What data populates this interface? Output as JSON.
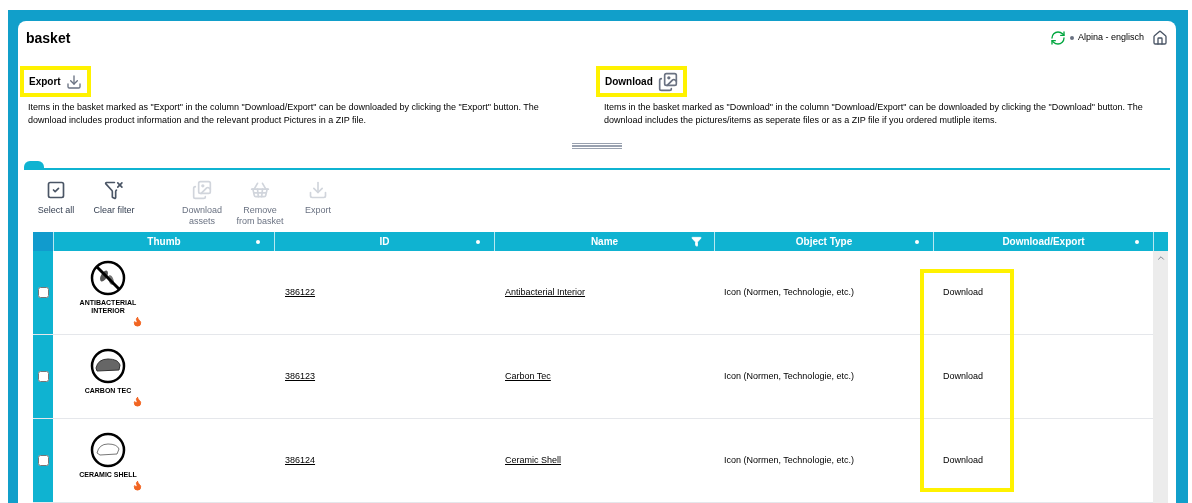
{
  "title": "basket",
  "header": {
    "account": "Alpina - englisch"
  },
  "info_sections": [
    {
      "kind": "export",
      "heading": "Export",
      "highlighted": true,
      "text": "Items in the basket marked as \"Export\" in the column \"Download/Export\" can be downloaded by clicking the \"Export\" button. The download includes product information and the relevant product Pictures in a ZIP file."
    },
    {
      "kind": "download",
      "heading": "Download",
      "highlighted": true,
      "text": "Items in the basket marked as \"Download\" in the column \"Download/Export\" can be downloaded by clicking the \"Download\" button. The download includes the pictures/items as seperate files or as a ZIP file if you ordered mutliple items."
    }
  ],
  "toolbar": [
    {
      "kind": "select",
      "label": "Select all",
      "disabled": false
    },
    {
      "kind": "clear-filter",
      "label": "Clear filter",
      "disabled": false
    },
    {
      "kind": "download",
      "label": "Download assets",
      "disabled": true
    },
    {
      "kind": "remove",
      "label": "Remove from basket",
      "disabled": true
    },
    {
      "kind": "export",
      "label": "Export",
      "disabled": true
    }
  ],
  "table": {
    "columns": [
      {
        "label": "Thumb",
        "filtered": false
      },
      {
        "label": "ID",
        "filtered": false
      },
      {
        "label": "Name",
        "filtered": true
      },
      {
        "label": "Object Type",
        "filtered": false
      },
      {
        "label": "Download/Export",
        "filtered": false,
        "highlighted": true
      }
    ],
    "rows": [
      {
        "checked": false,
        "kind": "antibacterial",
        "thumb_label": "ANTIBACTERIAL INTERIOR",
        "id": "386122",
        "name": "Antibacterial Interior",
        "object_type": "Icon (Normen, Technologie, etc.)",
        "action": "Download"
      },
      {
        "checked": false,
        "kind": "carbon",
        "thumb_label": "CARBON TEC",
        "id": "386123",
        "name": "Carbon Tec",
        "object_type": "Icon (Normen, Technologie, etc.)",
        "action": "Download"
      },
      {
        "checked": false,
        "kind": "ceramic",
        "thumb_label": "CERAMIC SHELL",
        "id": "386124",
        "name": "Ceramic Shell",
        "object_type": "Icon (Normen, Technologie, etc.)",
        "action": "Download"
      }
    ]
  }
}
